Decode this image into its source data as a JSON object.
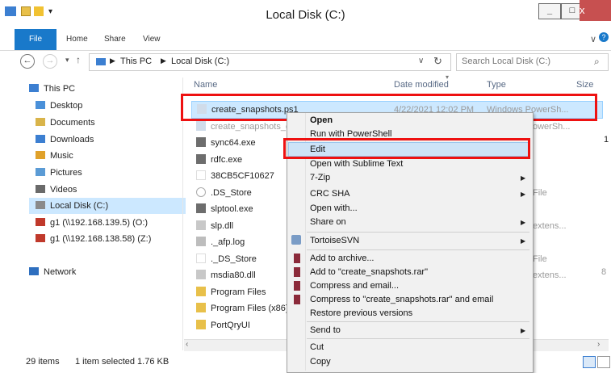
{
  "window": {
    "title": "Local Disk (C:)",
    "minimize": "_",
    "maximize": "□",
    "close": "x"
  },
  "ribbon": {
    "tabs": [
      "File",
      "Home",
      "Share",
      "View"
    ]
  },
  "address": {
    "segments": [
      "This PC",
      "Local Disk (C:)"
    ],
    "search_placeholder": "Search Local Disk (C:)"
  },
  "nav_pane": {
    "items": [
      {
        "label": "This PC",
        "icon": "computer-icon"
      },
      {
        "label": "Desktop",
        "icon": "desktop-icon"
      },
      {
        "label": "Documents",
        "icon": "documents-icon"
      },
      {
        "label": "Downloads",
        "icon": "downloads-icon"
      },
      {
        "label": "Music",
        "icon": "music-icon"
      },
      {
        "label": "Pictures",
        "icon": "pictures-icon"
      },
      {
        "label": "Videos",
        "icon": "videos-icon"
      },
      {
        "label": "Local Disk (C:)",
        "icon": "drive-icon"
      },
      {
        "label": "g1 (\\\\192.168.139.5) (O:)",
        "icon": "network-drive-icon"
      },
      {
        "label": "g1 (\\\\192.168.138.58) (Z:)",
        "icon": "network-drive-icon"
      },
      {
        "label": "Network",
        "icon": "network-icon"
      }
    ]
  },
  "columns": {
    "name": "Name",
    "date": "Date modified",
    "type": "Type",
    "size": "Size"
  },
  "files": [
    {
      "name": "create_snapshots.ps1",
      "date": "4/22/2021 12:02 PM",
      "type": "Windows PowerSh..."
    },
    {
      "name": "create_snapshots_c",
      "date": "",
      "type": "owerSh..."
    },
    {
      "name": "sync64.exe",
      "date": "",
      "type": ""
    },
    {
      "name": "rdfc.exe",
      "date": "",
      "type": ""
    },
    {
      "name": "38CB5CF10627",
      "date": "",
      "type": ""
    },
    {
      "name": ".DS_Store",
      "date": "",
      "type": "File"
    },
    {
      "name": "slptool.exe",
      "date": "",
      "type": ""
    },
    {
      "name": "slp.dll",
      "date": "",
      "type": "extens..."
    },
    {
      "name": "._afp.log",
      "date": "",
      "type": ""
    },
    {
      "name": "._DS_Store",
      "date": "",
      "type": "File"
    },
    {
      "name": "msdia80.dll",
      "date": "",
      "type": "extens..."
    },
    {
      "name": "Program Files",
      "date": "",
      "type": ""
    },
    {
      "name": "Program Files (x86)",
      "date": "",
      "type": ""
    },
    {
      "name": "PortQryUI",
      "date": "",
      "type": ""
    }
  ],
  "context_menu": {
    "items": [
      {
        "label": "Open",
        "bold": true
      },
      {
        "label": "Run with PowerShell"
      },
      {
        "label": "Edit",
        "highlighted": true
      },
      {
        "label": "Open with Sublime Text"
      },
      {
        "label": "7-Zip",
        "submenu": true
      },
      {
        "label": "CRC SHA",
        "submenu": true
      },
      {
        "label": "Open with..."
      },
      {
        "label": "Share on",
        "submenu": true
      },
      {
        "label": "TortoiseSVN",
        "submenu": true
      },
      {
        "label": "Add to archive..."
      },
      {
        "label": "Add to \"create_snapshots.rar\""
      },
      {
        "label": "Compress and email..."
      },
      {
        "label": "Compress to \"create_snapshots.rar\" and email"
      },
      {
        "label": "Restore previous versions"
      },
      {
        "label": "Send to",
        "submenu": true
      },
      {
        "label": "Cut"
      },
      {
        "label": "Copy"
      }
    ]
  },
  "status": {
    "item_count": "29 items",
    "selection": "1 item selected  1.76 KB"
  },
  "colors": {
    "accent": "#1979ca",
    "selection": "#cce8ff",
    "highlight_box": "#e11111",
    "close_button": "#c75050"
  }
}
